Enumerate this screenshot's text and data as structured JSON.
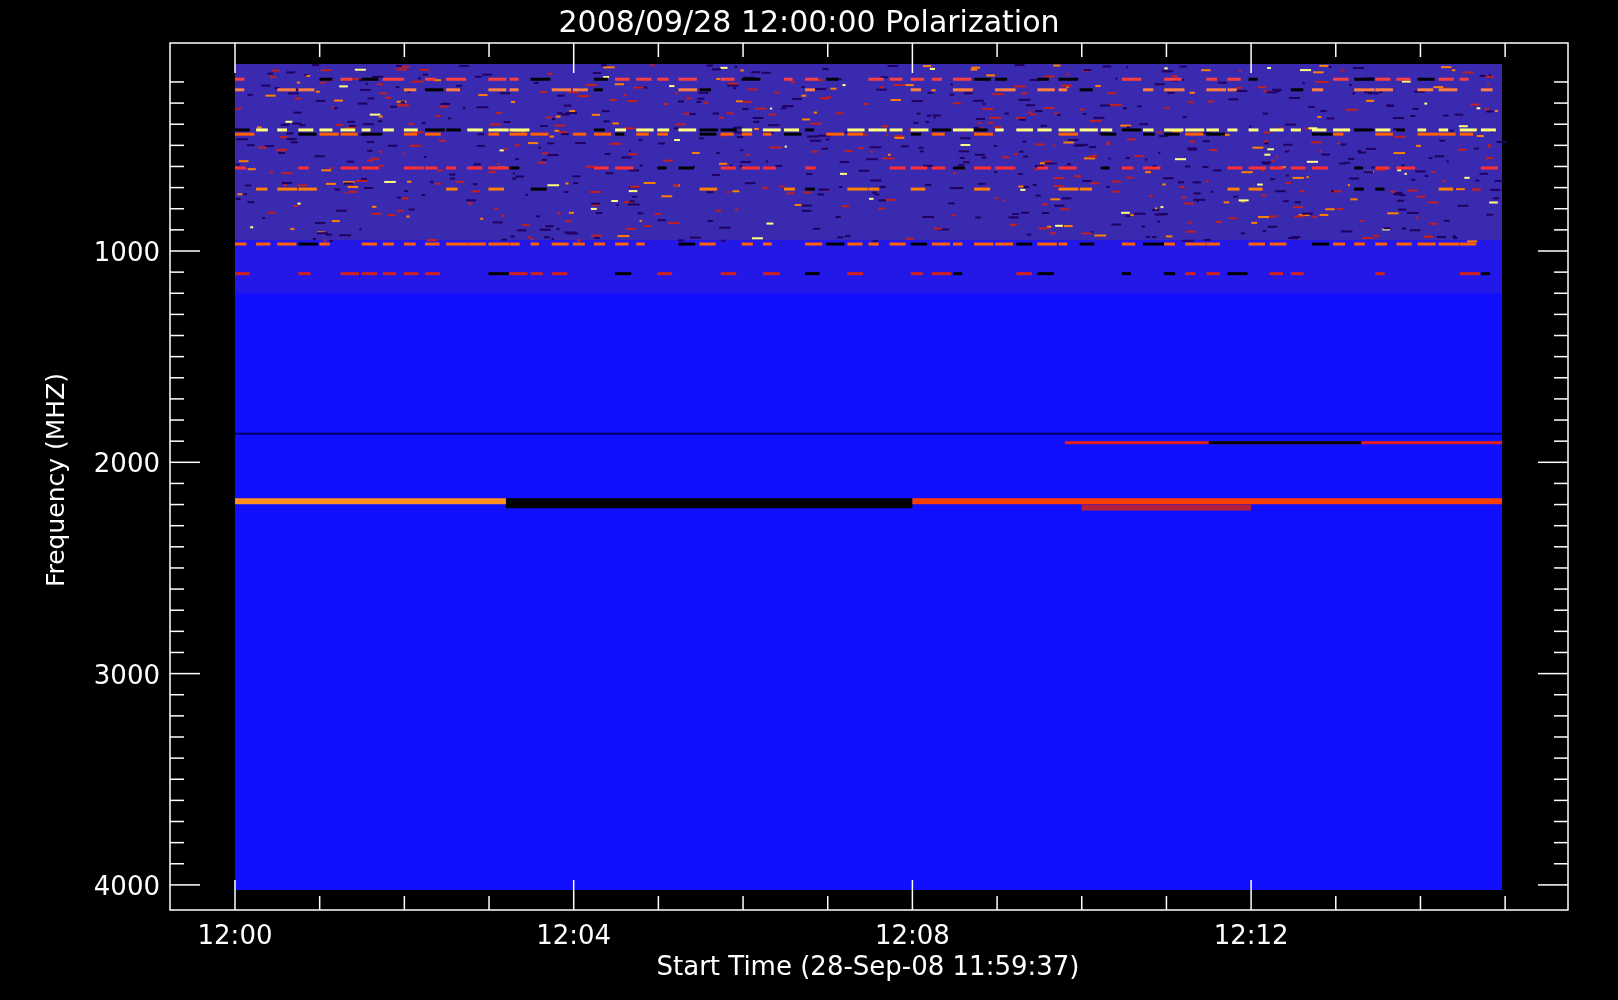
{
  "title": "2008/09/28 12:00:00 Polarization",
  "y_axis": {
    "label": "Frequency (MHZ)",
    "ticks": [
      "1000",
      "2000",
      "3000",
      "4000"
    ]
  },
  "x_axis": {
    "label": "Start Time (28-Sep-08 11:59:37)",
    "ticks": [
      "12:00",
      "12:04",
      "12:08",
      "12:12"
    ]
  }
}
